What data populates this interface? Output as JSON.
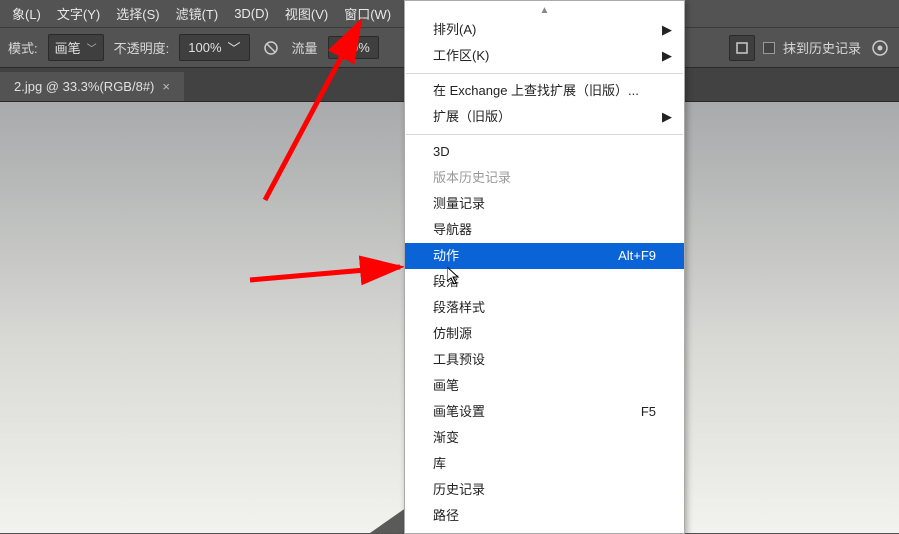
{
  "menubar": {
    "items": [
      "象(L)",
      "文字(Y)",
      "选择(S)",
      "滤镜(T)",
      "3D(D)",
      "视图(V)",
      "窗口(W)"
    ]
  },
  "toolbar": {
    "mode_label": "模式:",
    "brush_label": "画笔",
    "opacity_label": "不透明度:",
    "opacity_value": "100%",
    "flow_label": "流量",
    "flow_value": "100%",
    "history_label": "抹到历史记录"
  },
  "tab": {
    "title": "2.jpg @ 33.3%(RGB/8#)",
    "close": "×"
  },
  "menu": {
    "arrange": {
      "label": "排列(A)"
    },
    "workspace": {
      "label": "工作区(K)"
    },
    "exchange": {
      "label": "在 Exchange 上查找扩展（旧版）..."
    },
    "extension": {
      "label": "扩展（旧版）"
    },
    "threed": {
      "label": "3D"
    },
    "verhist": {
      "label": "版本历史记录"
    },
    "measure": {
      "label": "测量记录"
    },
    "nav": {
      "label": "导航器"
    },
    "action": {
      "label": "动作",
      "shortcut": "Alt+F9"
    },
    "para": {
      "label": "段落"
    },
    "parastyle": {
      "label": "段落样式"
    },
    "clone": {
      "label": "仿制源"
    },
    "toolpreset": {
      "label": "工具预设"
    },
    "brush": {
      "label": "画笔"
    },
    "brushset": {
      "label": "画笔设置",
      "shortcut": "F5"
    },
    "gradient": {
      "label": "渐变"
    },
    "library": {
      "label": "库"
    },
    "history": {
      "label": "历史记录"
    },
    "path": {
      "label": "路径"
    }
  }
}
